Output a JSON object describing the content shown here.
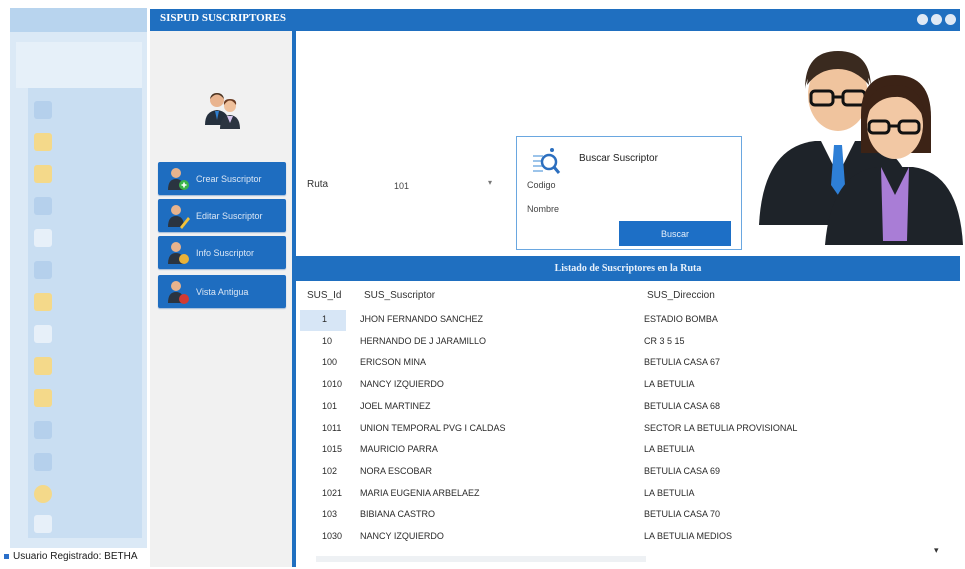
{
  "window": {
    "title": "SISPUD SUSCRIPTORES"
  },
  "status": {
    "text": "Usuario Registrado: BETHA"
  },
  "menu": [
    {
      "label": "Crear Suscriptor",
      "icon": "user-add-icon"
    },
    {
      "label": "Editar Suscriptor",
      "icon": "user-edit-icon"
    },
    {
      "label": "Info Suscriptor",
      "icon": "user-info-icon"
    },
    {
      "label": "Vista Antigua",
      "icon": "user-old-view-icon"
    }
  ],
  "filter": {
    "ruta_label": "Ruta",
    "ruta_value": "101"
  },
  "search": {
    "title": "Buscar Suscriptor",
    "codigo_label": "Codigo",
    "nombre_label": "Nombre",
    "button": "Buscar"
  },
  "list": {
    "title": "Listado de Suscriptores en la Ruta",
    "columns": [
      "SUS_Id",
      "SUS_Suscriptor",
      "SUS_Direccion"
    ],
    "rows": [
      {
        "id": "1",
        "name": "JHON FERNANDO SANCHEZ",
        "address": "ESTADIO BOMBA"
      },
      {
        "id": "10",
        "name": "HERNANDO DE J JARAMILLO",
        "address": "CR 3 5 15"
      },
      {
        "id": "100",
        "name": "ERICSON MINA",
        "address": "BETULIA CASA 67"
      },
      {
        "id": "1010",
        "name": "NANCY IZQUIERDO",
        "address": "LA BETULIA"
      },
      {
        "id": "101",
        "name": "JOEL MARTINEZ",
        "address": "BETULIA CASA 68"
      },
      {
        "id": "1011",
        "name": "UNION TEMPORAL PVG I CALDAS",
        "address": "SECTOR LA BETULIA PROVISIONAL"
      },
      {
        "id": "1015",
        "name": "MAURICIO PARRA",
        "address": "LA BETULIA"
      },
      {
        "id": "102",
        "name": "NORA ESCOBAR",
        "address": "BETULIA CASA 69"
      },
      {
        "id": "1021",
        "name": "MARIA EUGENIA ARBELAEZ",
        "address": "LA BETULIA"
      },
      {
        "id": "103",
        "name": "BIBIANA CASTRO",
        "address": "BETULIA CASA 70"
      },
      {
        "id": "1030",
        "name": "NANCY IZQUIERDO",
        "address": "LA BETULIA MEDIOS"
      }
    ]
  },
  "colors": {
    "accent": "#1f6fc0",
    "button": "#1e6dc0",
    "selection": "#d7e6f6"
  }
}
